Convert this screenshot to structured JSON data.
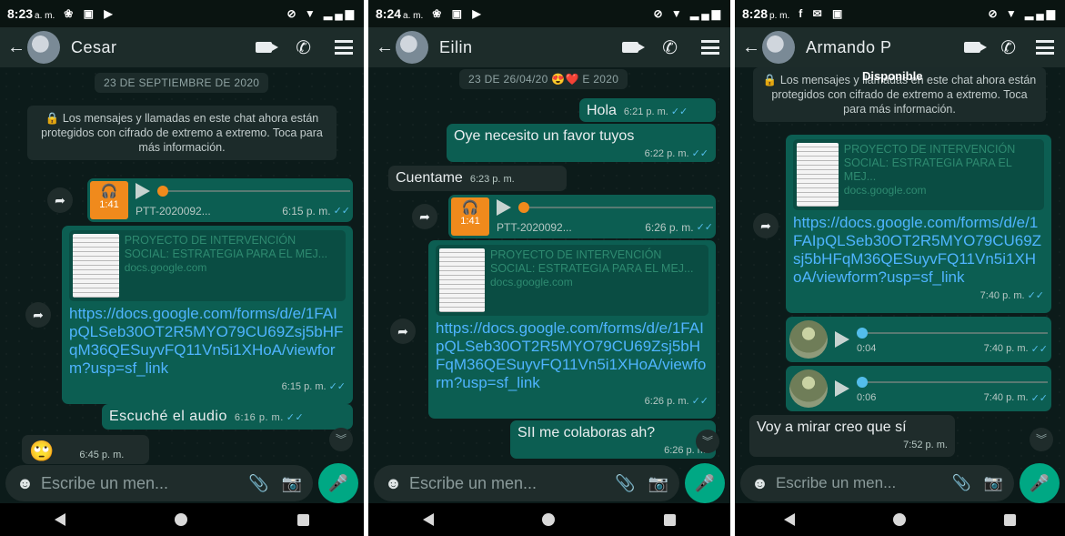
{
  "screens": [
    {
      "status_time": "8:23",
      "status_ampm": "a. m.",
      "status_icons": "❀ ▣ ▶",
      "contact": "Cesar",
      "date_chip": "23 DE SEPTIEMBRE DE 2020",
      "encryption_notice": "Los mensajes y llamadas en este chat ahora están protegidos con cifrado de extremo a extremo. Toca para más información.",
      "audio": {
        "duration": "1:41",
        "filename": "PTT-2020092...",
        "time": "6:15 p. m."
      },
      "doc_title": "PROYECTO DE INTERVENCIÓN SOCIAL: ESTRATEGIA PARA EL MEJ...",
      "doc_host": "docs.google.com",
      "link": "https://docs.google.com/forms/d/e/1FAIpQLSeb30OT2R5MYO79CU69Zsj5bHFqM36QESuyvFQ11Vn5i1XHoA/viewform?usp=sf_link",
      "link_time": "6:15 p. m.",
      "msg_out": "Escuché el audio",
      "msg_out_time": "6:16 p. m.",
      "msg_in_emoji": "🙄",
      "msg_in_time": "6:45 p. m."
    },
    {
      "status_time": "8:24",
      "status_ampm": "a. m.",
      "status_icons": "❀ ▣ ▶",
      "contact": "Eilin",
      "date_chip": "23 DE 26/04/20 😍❤️ E 2020",
      "msg1": "Hola",
      "msg1_time": "6:21 p. m.",
      "msg2": "Oye necesito un favor tuyos",
      "msg2_time": "6:22 p. m.",
      "msg_in": "Cuentame",
      "msg_in_time": "6:23 p. m.",
      "audio": {
        "duration": "1:41",
        "filename": "PTT-2020092...",
        "time": "6:26 p. m."
      },
      "doc_title": "PROYECTO DE INTERVENCIÓN SOCIAL: ESTRATEGIA PARA EL MEJ...",
      "doc_host": "docs.google.com",
      "link": "https://docs.google.com/forms/d/e/1FAIpQLSeb30OT2R5MYO79CU69Zsj5bHFqM36QESuyvFQ11Vn5i1XHoA/viewform?usp=sf_link",
      "link_time": "6:26 p. m.",
      "msg3": "SII me colaboras ah?",
      "msg3_time": "6:26 p. m."
    },
    {
      "status_time": "8:28",
      "status_ampm": "p. m.",
      "status_icons": "f ✉ ▣",
      "contact": "Armando P",
      "presence": "Disponible",
      "encryption_notice": "Los mensajes y llamadas en este chat ahora están protegidos con cifrado de extremo a extremo. Toca para más información.",
      "doc_title": "PROYECTO DE INTERVENCIÓN SOCIAL: ESTRATEGIA PARA EL MEJ...",
      "doc_host": "docs.google.com",
      "link": "https://docs.google.com/forms/d/e/1FAIpQLSeb30OT2R5MYO79CU69Zsj5bHFqM36QESuyvFQ11Vn5i1XHoA/viewform?usp=sf_link",
      "link_time": "7:40 p. m.",
      "voice1": {
        "duration": "0:04",
        "time": "7:40 p. m."
      },
      "voice2": {
        "duration": "0:06",
        "time": "7:40 p. m."
      },
      "msg_in": "Voy a mirar creo que sí",
      "msg_in_time": "7:52 p. m."
    }
  ],
  "composer_placeholder": "Escribe un men...",
  "colors": {
    "outgoing": "#0c5e52",
    "incoming": "#1f2c2b",
    "accent": "#00a884",
    "audio_badge": "#f08a1c",
    "link": "#4fb4ff"
  }
}
